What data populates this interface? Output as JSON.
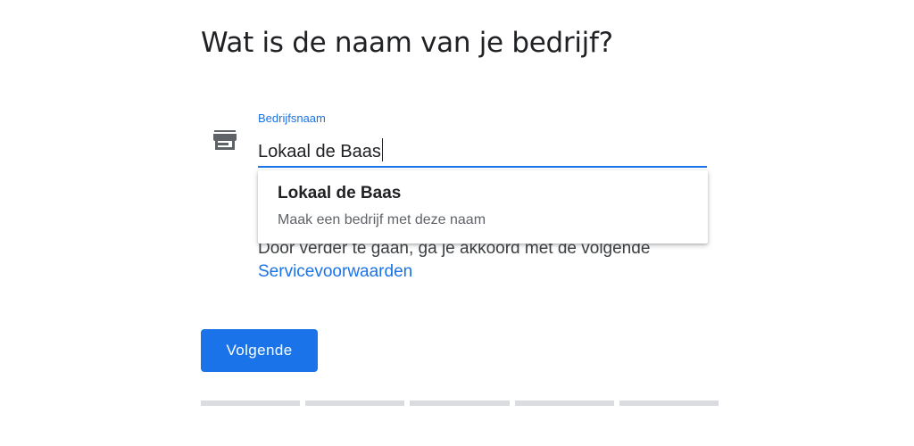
{
  "heading": "Wat is de naam van je bedrijf?",
  "business_name_field": {
    "label": "Bedrijfsnaam",
    "value": "Lokaal de Baas",
    "icon": "store-icon"
  },
  "suggestion": {
    "title": "Lokaal de Baas",
    "subtitle": "Maak een bedrijf met deze naam"
  },
  "terms": {
    "text": "Door verder te gaan, ga je akkoord met de volgende",
    "link": "Servicevoorwaarden"
  },
  "next_button": "Volgende",
  "progress": {
    "steps_total": 5,
    "steps_complete": 0
  },
  "colors": {
    "accent": "#1a73e8",
    "text": "#202124",
    "muted": "#5f6368",
    "progress_track": "#dadce0"
  }
}
